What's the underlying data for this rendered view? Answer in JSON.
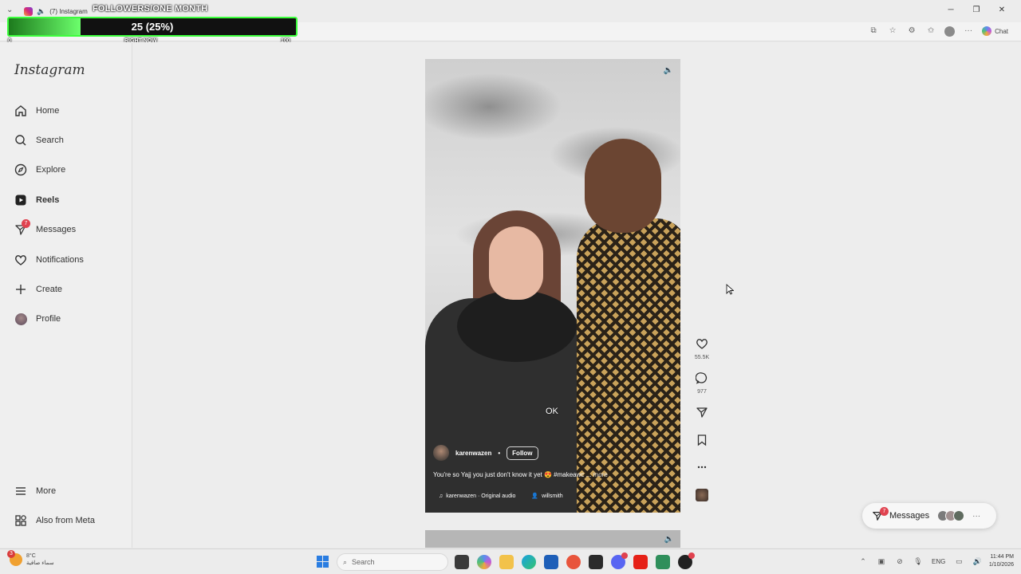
{
  "browser": {
    "tab_title": "(7) Instagram",
    "chat_label": "Chat"
  },
  "overlay": {
    "title": "FOLLOWERS/ONE MONTH",
    "value_text": "25 (25%)",
    "progress_fraction": 0.25,
    "scale_min": "0",
    "scale_mid": "RIGHT NOW",
    "scale_max": "100",
    "accent_color": "#3cff3c"
  },
  "sidebar": {
    "logo": "Instagram",
    "items": [
      {
        "label": "Home",
        "icon": "home-icon"
      },
      {
        "label": "Search",
        "icon": "search-icon"
      },
      {
        "label": "Explore",
        "icon": "compass-icon"
      },
      {
        "label": "Reels",
        "icon": "reels-icon"
      },
      {
        "label": "Messages",
        "icon": "messenger-icon",
        "badge": "7"
      },
      {
        "label": "Notifications",
        "icon": "heart-icon"
      },
      {
        "label": "Create",
        "icon": "plus-icon"
      },
      {
        "label": "Profile",
        "icon": "avatar"
      }
    ],
    "more": "More",
    "also_from_meta": "Also from Meta"
  },
  "reel": {
    "overlay_text": "OK",
    "author": "karenwazen",
    "separator": "•",
    "follow_label": "Follow",
    "caption": "You're so Yajj you just don't know it yet 😍 #makeawc ...",
    "caption_more": "more",
    "audio": "karenwazen · Original audio",
    "tagged_user": "willsmith"
  },
  "actions": {
    "likes": "55.5K",
    "comments": "977"
  },
  "messages_pill": {
    "label": "Messages",
    "badge": "7",
    "more": "···"
  },
  "taskbar": {
    "weather_badge": "3",
    "weather_temp": "8°C",
    "weather_desc": "سماء صافية",
    "search_placeholder": "Search",
    "tray_lang": "ENG",
    "time": "11:44 PM",
    "date": "1/10/2026"
  }
}
